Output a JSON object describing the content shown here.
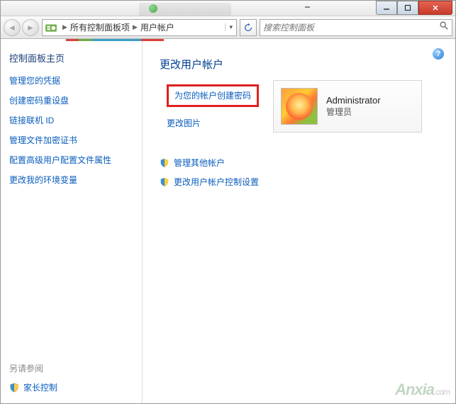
{
  "window_controls": {
    "min": "─",
    "max": "□",
    "close": "✕"
  },
  "breadcrumb": {
    "item1": "所有控制面板项",
    "item2": "用户帐户"
  },
  "search": {
    "placeholder": "搜索控制面板"
  },
  "sidebar": {
    "title": "控制面板主页",
    "links": [
      "管理您的凭据",
      "创建密码重设盘",
      "链接联机 ID",
      "管理文件加密证书",
      "配置高级用户配置文件属性",
      "更改我的环境变量"
    ],
    "see_also": "另请参阅",
    "parental": "家长控制"
  },
  "main": {
    "heading": "更改用户帐户",
    "create_password": "为您的帐户创建密码",
    "change_picture": "更改图片",
    "manage_other": "管理其他帐户",
    "change_uac": "更改用户帐户控制设置"
  },
  "user": {
    "name": "Administrator",
    "role": "管理员"
  },
  "watermark": {
    "brand": "Anxia",
    "suffix": ".com"
  }
}
